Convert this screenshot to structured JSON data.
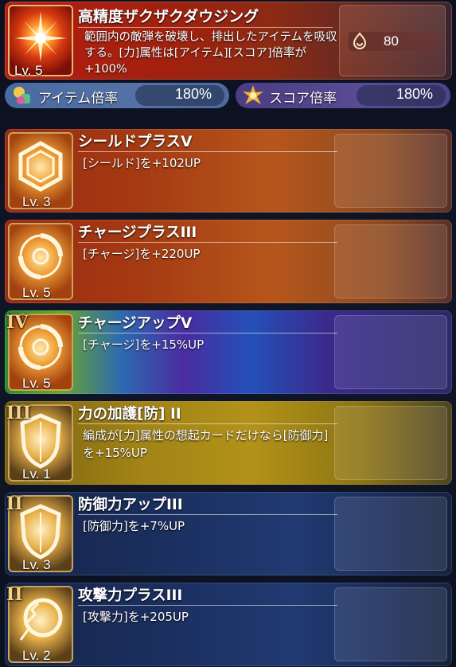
{
  "top_skill": {
    "name": "高精度ザクザクダウジング",
    "level": "Lv. 5",
    "description": "範囲内の敵弾を破壊し、排出したアイテムを吸収する。[力]属性は[アイテム][スコア]倍率が+100%",
    "value": "80",
    "icon": "starburst-icon",
    "value_icon": "drop-swirl-icon"
  },
  "rates": {
    "item": {
      "label": "アイテム倍率",
      "value": "180%",
      "icon": "item-bag-icon"
    },
    "score": {
      "label": "スコア倍率",
      "value": "180%",
      "icon": "star-burst-icon"
    }
  },
  "skills": [
    {
      "name": "シールドプラスV",
      "level": "Lv. 3",
      "description": "[シールド]を+102UP",
      "rank": "",
      "icon": "hexagon-shield-icon",
      "color": "orange"
    },
    {
      "name": "チャージプラスIII",
      "level": "Lv. 5",
      "description": "[チャージ]を+220UP",
      "rank": "",
      "icon": "swirl-icon",
      "color": "orange"
    },
    {
      "name": "チャージアップV",
      "level": "Lv. 5",
      "description": "[チャージ]を+15%UP",
      "rank": "IV",
      "icon": "swirl-icon",
      "color": "rainbow"
    },
    {
      "name": "力の加護[防] II",
      "level": "Lv. 1",
      "description": "編成が[力]属性の想起カードだけなら[防御力]を+15%UP",
      "rank": "III",
      "icon": "shield-icon",
      "color": "gold"
    },
    {
      "name": "防御力アップIII",
      "level": "Lv. 3",
      "description": "[防御力]を+7%UP",
      "rank": "II",
      "icon": "shield-icon",
      "color": "blue"
    },
    {
      "name": "攻撃力プラスIII",
      "level": "Lv. 2",
      "description": "[攻撃力]を+205UP",
      "rank": "II",
      "icon": "cracked-circle-icon",
      "color": "blue"
    }
  ],
  "colors": {
    "accent_gold": "#f3d28a",
    "orange_card": "#a53a12",
    "gold_card": "#a18317",
    "blue_card": "#1c3162"
  }
}
